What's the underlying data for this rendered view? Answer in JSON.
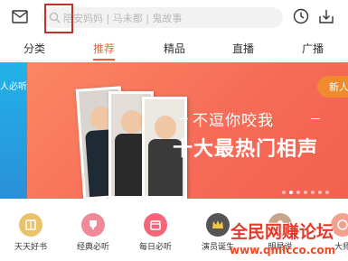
{
  "header": {
    "search_placeholder": "陪安妈妈 | 马未都 | 鬼故事",
    "icons": [
      "mail-icon",
      "search-icon",
      "history-clock-icon",
      "download-icon"
    ]
  },
  "tabs": [
    {
      "label": "分类",
      "active": false
    },
    {
      "label": "推荐",
      "active": true
    },
    {
      "label": "精品",
      "active": false
    },
    {
      "label": "直播",
      "active": false
    },
    {
      "label": "广播",
      "active": false
    }
  ],
  "banner": {
    "left_peek_text": "人必听",
    "slogan": "不逗你咬我",
    "headline": "十大最热门相声",
    "right_pill_text": "新人",
    "dots_total": 7,
    "dots_active_index": 1
  },
  "quick_entries": [
    {
      "label": "天天好书",
      "icon": "book-icon",
      "color": "#e8c36b"
    },
    {
      "label": "经典必听",
      "icon": "trophy-icon",
      "color": "#f08a9b"
    },
    {
      "label": "每日必听",
      "icon": "calendar-icon",
      "color": "#f4677a"
    },
    {
      "label": "演员诞生",
      "icon": "crown-icon",
      "color": "#555555"
    },
    {
      "label": "明星说",
      "icon": "person-icon",
      "color": "#c7a58a"
    },
    {
      "label": "大师",
      "icon": "master-icon",
      "color": "#f3a08f"
    }
  ],
  "watermark": {
    "text": "全民网赚论坛",
    "url": "www.qmlcco.com"
  },
  "colors": {
    "accent": "#f1633a",
    "banner_gradient_start": "#fb8763",
    "banner_gradient_end": "#f3604f",
    "left_banner": "#22b3e8",
    "highlight_box": "#c4302b"
  }
}
